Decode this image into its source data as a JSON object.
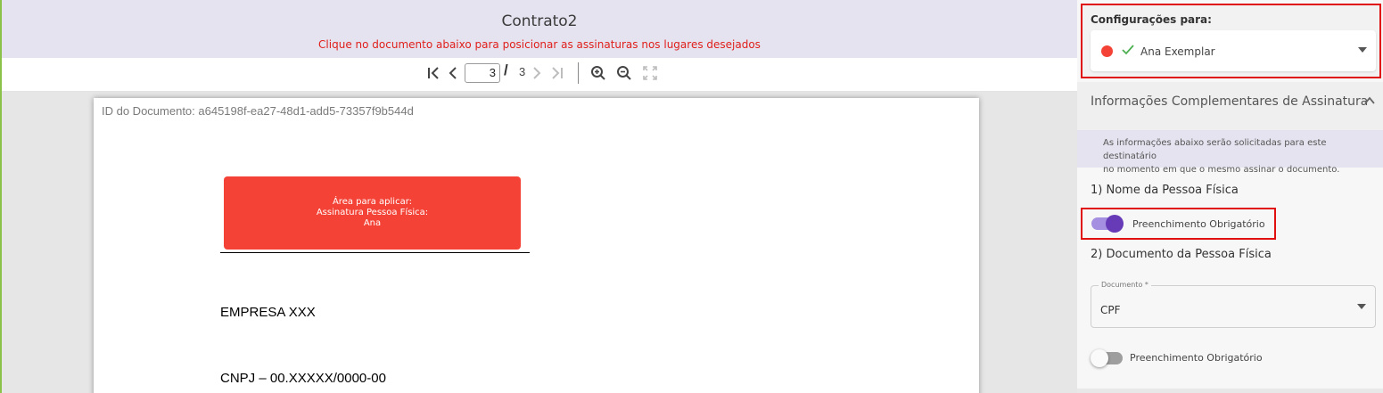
{
  "viewer": {
    "title": "Contrato2",
    "hint": "Clique no documento abaixo para posicionar as assinaturas nos lugares desejados",
    "toolbar": {
      "current_page": "3",
      "separator": "/",
      "total_pages": "3",
      "icons": [
        "first-page-icon",
        "prev-page-icon",
        "next-page-icon",
        "last-page-icon",
        "zoom-in-icon",
        "zoom-out-icon",
        "fullscreen-icon"
      ]
    }
  },
  "document": {
    "id_text": "ID do Documento: a645198f-ea27-48d1-add5-73357f9b544d",
    "signature_area": {
      "line1": "Área para aplicar:",
      "line2": "Assinatura Pessoa Física:",
      "line3": "Ana",
      "color": "#f44336"
    },
    "company": "EMPRESA XXX",
    "cnpj": "CNPJ – 00.XXXXX/0000-00"
  },
  "panel": {
    "config_label": "Configurações para:",
    "signer": {
      "name": "Ana Exemplar",
      "status_color": "#f44336",
      "status_icon": "check-icon"
    },
    "info": {
      "title": "Informações Complementares de Assinatura",
      "note_line1": "As informações abaixo serão solicitadas para este destinatário",
      "note_line2": "no momento em que o mesmo assinar o documento."
    },
    "fields": [
      {
        "title": "1) Nome da Pessoa Física",
        "required_label": "Preenchimento Obrigatório",
        "required": true
      },
      {
        "title": "2) Documento da Pessoa Física",
        "required_label": "Preenchimento Obrigatório",
        "required": false,
        "select_label": "Documento *",
        "select_value": "CPF"
      }
    ]
  },
  "colors": {
    "accent_purple": "#673ab7",
    "highlight_red": "#e01010",
    "header_bg": "#e4e3ef"
  }
}
